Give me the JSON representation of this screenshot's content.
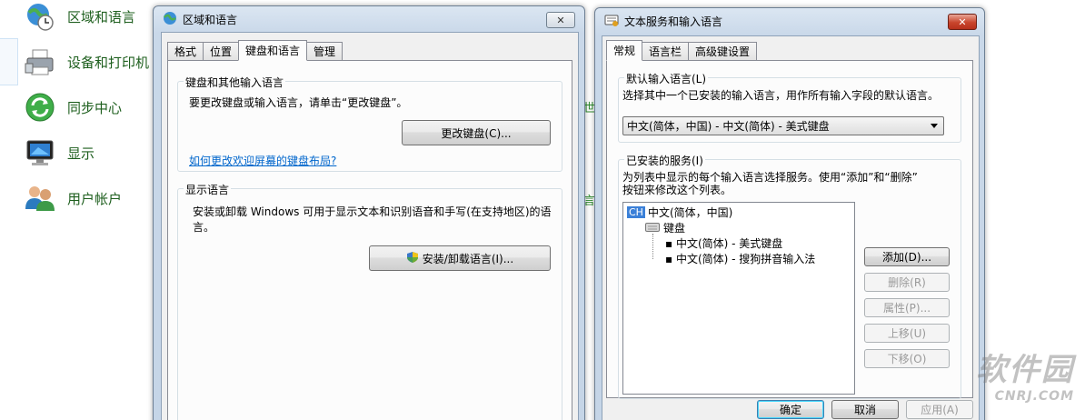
{
  "control_panel": {
    "items": [
      {
        "label": "区域和语言",
        "icon": "globe-clock-icon"
      },
      {
        "label": "设备和打印机",
        "icon": "printer-icon"
      },
      {
        "label": "同步中心",
        "icon": "sync-icon"
      },
      {
        "label": "显示",
        "icon": "monitor-icon"
      },
      {
        "label": "用户帐户",
        "icon": "users-icon"
      }
    ],
    "fragments": [
      "世",
      "言"
    ]
  },
  "region_window": {
    "title": "区域和语言",
    "close": "✕",
    "tabs": [
      "格式",
      "位置",
      "键盘和语言",
      "管理"
    ],
    "keyboard_group": {
      "label": "键盘和其他输入语言",
      "text": "要更改键盘或输入语言，请单击“更改键盘”。",
      "button": "更改键盘(C)...",
      "link": "如何更改欢迎屏幕的键盘布局?"
    },
    "display_group": {
      "label": "显示语言",
      "text_line1": "安装或卸载 Windows 可用于显示文本和识别语音和手写(在支持地区)的语",
      "text_line2": "言。",
      "button": "安装/卸载语言(I)..."
    }
  },
  "text_services_window": {
    "title": "文本服务和输入语言",
    "close": "✕",
    "tabs": [
      "常规",
      "语言栏",
      "高级键设置"
    ],
    "default_group": {
      "label": "默认输入语言(L)",
      "text": "选择其中一个已安装的输入语言，用作所有输入字段的默认语言。",
      "selected": "中文(简体，中国) - 中文(简体) - 美式键盘"
    },
    "installed_group": {
      "label": "已安装的服务(I)",
      "text_line1": "为列表中显示的每个输入语言选择服务。使用“添加”和“删除”",
      "text_line2": "按钮来修改这个列表。",
      "tree": {
        "lang_badge": "CH",
        "lang": "中文(简体，中国)",
        "category": "键盘",
        "items": [
          "中文(简体) - 美式键盘",
          "中文(简体) - 搜狗拼音输入法"
        ]
      },
      "buttons": {
        "add": "添加(D)...",
        "remove": "删除(R)",
        "properties": "属性(P)...",
        "move_up": "上移(U)",
        "move_down": "下移(O)"
      }
    },
    "footer": {
      "ok": "确定",
      "cancel": "取消",
      "apply": "应用(A)"
    }
  },
  "watermark": {
    "main": "软件园",
    "sub": "CNRJ.COM"
  }
}
